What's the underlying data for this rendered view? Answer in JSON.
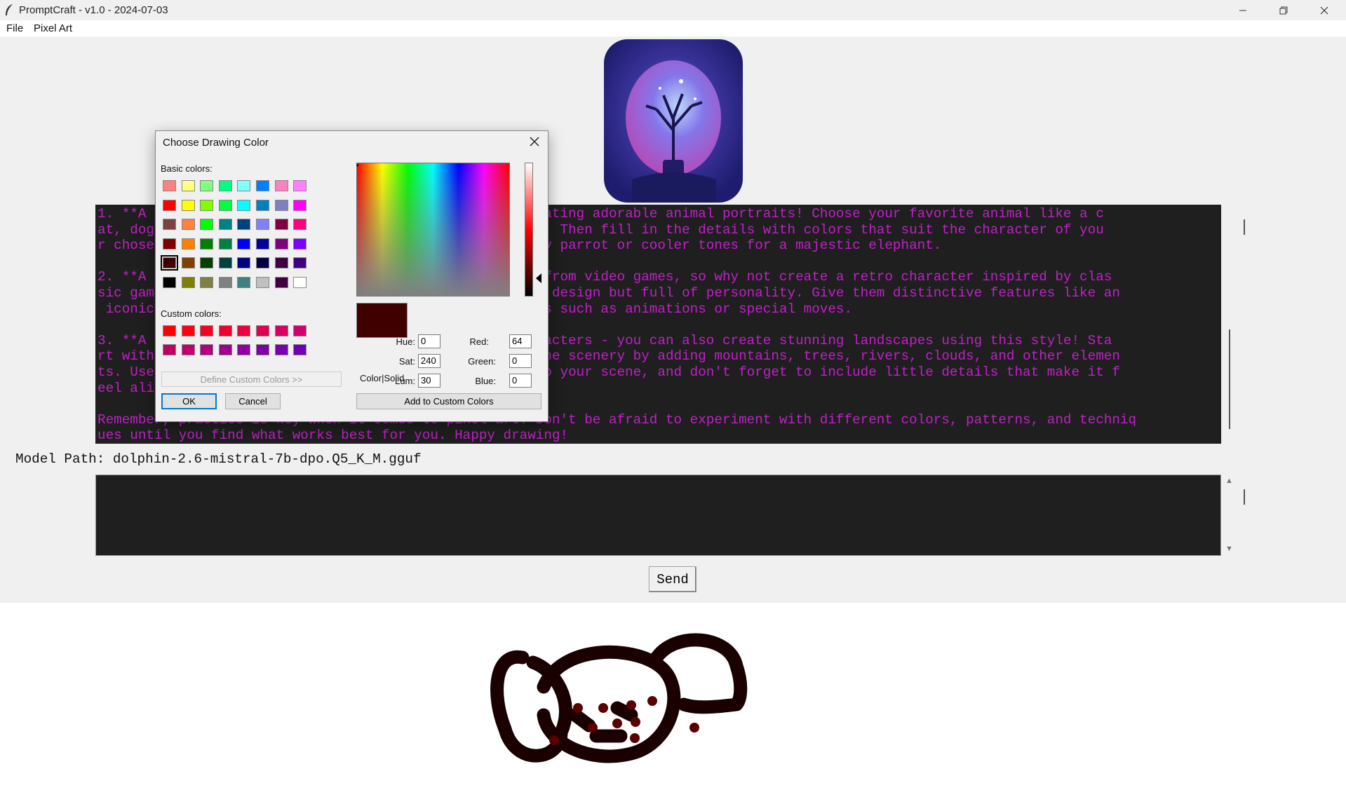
{
  "window": {
    "title": "PromptCraft - v1.0 - 2024-07-03",
    "minimize_icon": "minimize-icon",
    "maximize_icon": "restore-icon",
    "close_icon": "close-icon"
  },
  "menu": [
    "File",
    "Pixel Art"
  ],
  "output": {
    "text_color": "#c020c8",
    "background": "#1f1f1f",
    "paragraphs": [
      [
        "1. **A                                          for creating adorable animal portraits! Choose your favorite animal like a c",
        "at, dog                                          shapes. Then fill in the details with colors that suit the character of you",
        "r chose                                          a sunny parrot or cooler tones for a majestic elephant."
      ],
      [
        "2. **A                                          inated from video games, so why not create a retro character inspired by clas",
        "sic gam                                          simple design but full of personality. Give them distinctive features like an",
        " iconic                                          details such as animations or special moves."
      ],
      [
        "3. **A                                          or characters - you can also create stunning landscapes using this style! Sta",
        "rt with                                          d up the scenery by adding mountains, trees, rivers, clouds, and other elemen",
        "ts. Use                                          ture to your scene, and don't forget to include little details that make it f",
        "eel ali"
      ],
      [
        "Remember, practice is key when it comes to pixel art! Don't be afraid to experiment with different colors, patterns, and techniq",
        "ues until you find what works best for you. Happy drawing!"
      ]
    ]
  },
  "model_path_label": "Model Path: dolphin-2.6-mistral-7b-dpo.Q5_K_M.gguf",
  "input": {
    "value": ""
  },
  "send_label": "Send",
  "dialog": {
    "title": "Choose Drawing Color",
    "basic_colors_label": "Basic colors:",
    "custom_colors_label": "Custom colors:",
    "define_custom_label": "Define Custom Colors >>",
    "ok_label": "OK",
    "cancel_label": "Cancel",
    "add_custom_label": "Add to Custom Colors",
    "color_solid_label": "Color|Solid",
    "hue_label": "Hue:",
    "hue": "0",
    "sat_label": "Sat:",
    "sat": "240",
    "lum_label": "Lum:",
    "lum": "30",
    "red_label": "Red:",
    "red": "64",
    "green_label": "Green:",
    "green": "0",
    "blue_label": "Blue:",
    "blue": "0",
    "selected_color": "#400000",
    "basic_colors": [
      [
        "#ff8080",
        "#ffff80",
        "#80ff80",
        "#00ff80",
        "#80ffff",
        "#0080ff",
        "#ff80c0",
        "#ff80ff"
      ],
      [
        "#ff0000",
        "#ffff00",
        "#80ff00",
        "#00ff40",
        "#00ffff",
        "#0080c0",
        "#8080c0",
        "#ff00ff"
      ],
      [
        "#804040",
        "#ff8040",
        "#00ff00",
        "#008080",
        "#004080",
        "#8080ff",
        "#800040",
        "#ff0080"
      ],
      [
        "#800000",
        "#ff8000",
        "#008000",
        "#008040",
        "#0000ff",
        "#0000a0",
        "#800080",
        "#8000ff"
      ],
      [
        "#400000",
        "#804000",
        "#004000",
        "#004040",
        "#000080",
        "#000040",
        "#400040",
        "#400080"
      ],
      [
        "#000000",
        "#808000",
        "#808040",
        "#808080",
        "#408080",
        "#c0c0c0",
        "#400040",
        "#ffffff"
      ]
    ],
    "custom_colors": [
      [
        "#ff0000",
        "#ff0010",
        "#f80020",
        "#f00030",
        "#e80040",
        "#e00050",
        "#d80060",
        "#d00070"
      ],
      [
        "#c00060",
        "#c00070",
        "#b00080",
        "#a00090",
        "#9000a0",
        "#8000a8",
        "#7800b0",
        "#7000b8"
      ]
    ]
  }
}
